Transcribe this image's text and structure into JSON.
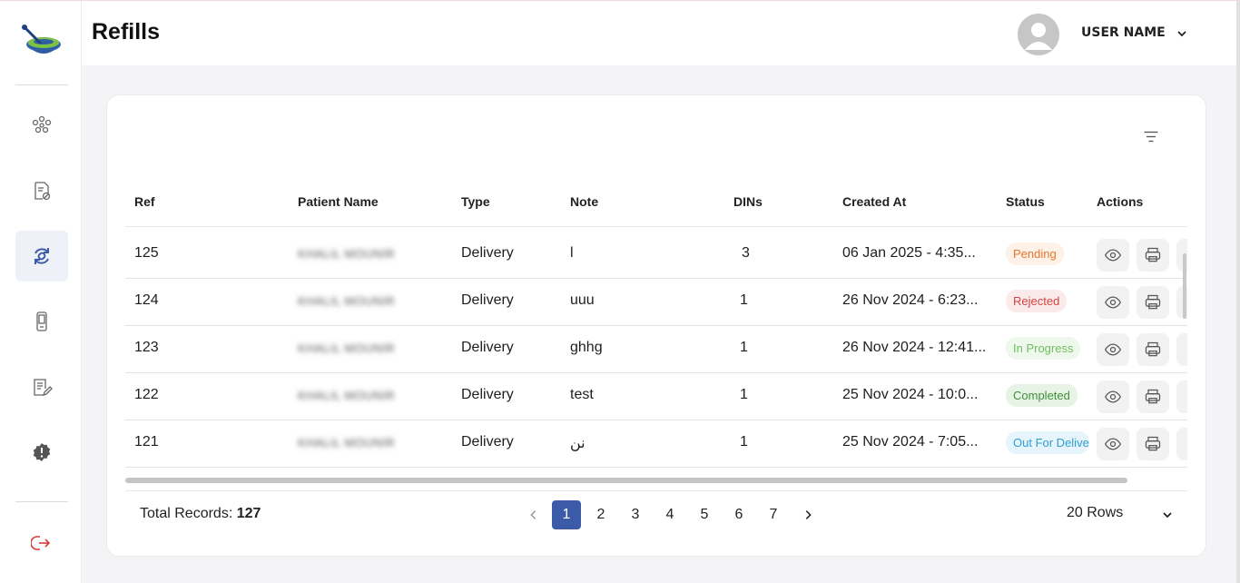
{
  "header": {
    "title": "Refills",
    "user_name": "USER NAME"
  },
  "sidebar": {
    "items": [
      {
        "name": "patients-icon"
      },
      {
        "name": "prescription-icon"
      },
      {
        "name": "refills-icon",
        "active": true
      },
      {
        "name": "device-icon"
      },
      {
        "name": "notes-icon"
      },
      {
        "name": "alert-icon"
      }
    ],
    "logout": "logout-icon"
  },
  "table": {
    "columns": [
      "Ref",
      "Patient Name",
      "Type",
      "Note",
      "DINs",
      "Created At",
      "Status",
      "Actions"
    ],
    "rows": [
      {
        "ref": "125",
        "patient": "KHALIL MOUNIR",
        "type": "Delivery",
        "note": "l",
        "dins": "3",
        "created": "06 Jan 2025 - 4:35...",
        "status": "Pending",
        "status_color": "#e8762c",
        "status_bg": "#fdf1e8"
      },
      {
        "ref": "124",
        "patient": "KHALIL MOUNIR",
        "type": "Delivery",
        "note": "uuu",
        "dins": "1",
        "created": "26 Nov 2024 - 6:23...",
        "status": "Rejected",
        "status_color": "#d94141",
        "status_bg": "#fbeaea"
      },
      {
        "ref": "123",
        "patient": "KHALIL MOUNIR",
        "type": "Delivery",
        "note": "ghhg",
        "dins": "1",
        "created": "26 Nov 2024 - 12:41...",
        "status": "In Progress",
        "status_color": "#6fbf5f",
        "status_bg": "#eef8ec"
      },
      {
        "ref": "122",
        "patient": "KHALIL MOUNIR",
        "type": "Delivery",
        "note": "test",
        "dins": "1",
        "created": "25 Nov 2024 - 10:0...",
        "status": "Completed",
        "status_color": "#3f8f3a",
        "status_bg": "#e7f4e5"
      },
      {
        "ref": "121",
        "patient": "KHALIL MOUNIR",
        "type": "Delivery",
        "note": "نن",
        "dins": "1",
        "created": "25 Nov 2024 - 7:05...",
        "status": "Out For Delivery",
        "status_color": "#2f9fd0",
        "status_bg": "#e6f4fb"
      }
    ]
  },
  "footer": {
    "total_label": "Total Records:",
    "total_value": "127",
    "pages": [
      "1",
      "2",
      "3",
      "4",
      "5",
      "6",
      "7"
    ],
    "current_page": "1",
    "rows_label": "20 Rows"
  },
  "colors": {
    "accent": "#3b5ba9",
    "logout": "#d93a3a"
  }
}
